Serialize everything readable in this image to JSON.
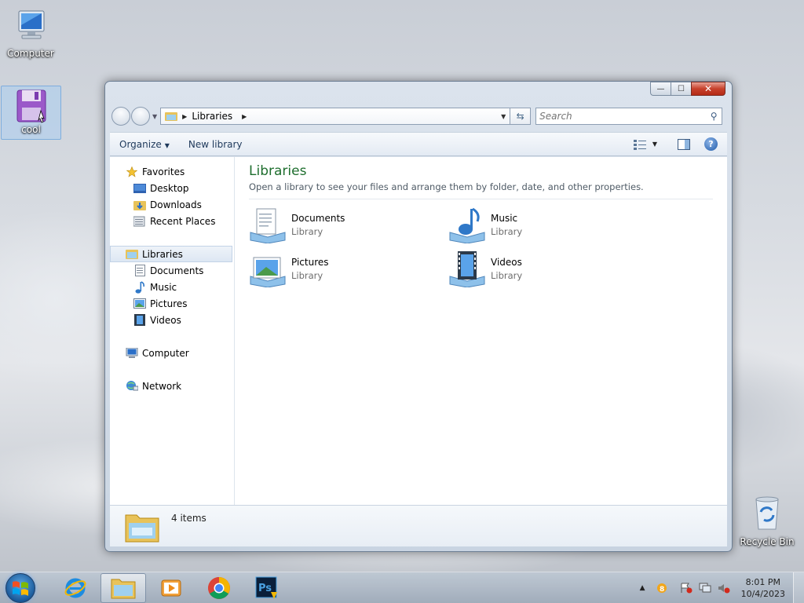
{
  "desktop": {
    "icons": [
      {
        "label": "Computer",
        "icon": "computer-icon"
      },
      {
        "label": "cool",
        "icon": "floppy-disk-icon"
      },
      {
        "label": "Recycle Bin",
        "icon": "recycle-bin-icon"
      }
    ]
  },
  "window": {
    "controls": {
      "minimize": "—",
      "maximize": "☐",
      "close": "✕"
    },
    "address": {
      "crumb": "Libraries"
    },
    "search": {
      "placeholder": "Search"
    },
    "toolbar": {
      "organize": "Organize",
      "new_library": "New library"
    },
    "nav_pane": {
      "favorites": {
        "label": "Favorites",
        "items": [
          "Desktop",
          "Downloads",
          "Recent Places"
        ]
      },
      "libraries": {
        "label": "Libraries",
        "items": [
          "Documents",
          "Music",
          "Pictures",
          "Videos"
        ]
      },
      "computer": "Computer",
      "network": "Network"
    },
    "content": {
      "title": "Libraries",
      "subtitle": "Open a library to see your files and arrange them by folder, date, and other properties.",
      "libraries": [
        {
          "name": "Documents",
          "type": "Library",
          "icon": "documents-library-icon"
        },
        {
          "name": "Music",
          "type": "Library",
          "icon": "music-library-icon"
        },
        {
          "name": "Pictures",
          "type": "Library",
          "icon": "pictures-library-icon"
        },
        {
          "name": "Videos",
          "type": "Library",
          "icon": "videos-library-icon"
        }
      ]
    },
    "details": {
      "count": "4 items"
    }
  },
  "taskbar": {
    "apps": [
      "internet-explorer-icon",
      "file-explorer-icon",
      "media-player-icon",
      "chrome-icon",
      "photoshop-icon"
    ],
    "clock": {
      "time": "8:01 PM",
      "date": "10/4/2023"
    }
  },
  "colors": {
    "title_green": "#1e6e2e",
    "toolbar_text": "#1e395b",
    "close_red": "#c7412c"
  }
}
